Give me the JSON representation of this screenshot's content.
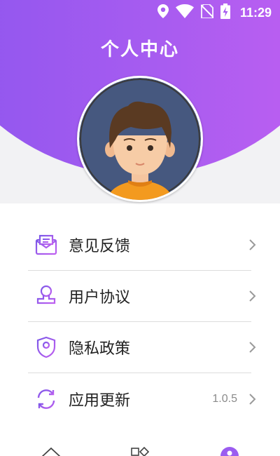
{
  "status_bar": {
    "time": "11:29",
    "icons": [
      "location-icon",
      "wifi-icon",
      "no-sim-icon",
      "battery-icon"
    ]
  },
  "header": {
    "title": "个人中心",
    "gradient_start": "#8b55ee",
    "gradient_end": "#c460f2"
  },
  "menu": {
    "items": [
      {
        "label": "意见反馈",
        "icon": "mail-icon",
        "value": ""
      },
      {
        "label": "用户协议",
        "icon": "stamp-icon",
        "value": ""
      },
      {
        "label": "隐私政策",
        "icon": "shield-lock-icon",
        "value": ""
      },
      {
        "label": "应用更新",
        "icon": "refresh-icon",
        "value": "1.0.5"
      }
    ]
  },
  "tab_bar": {
    "tabs": [
      {
        "icon": "home-icon"
      },
      {
        "icon": "apps-icon"
      },
      {
        "icon": "profile-icon",
        "active": true
      }
    ],
    "accent": "#9b5cf0"
  }
}
